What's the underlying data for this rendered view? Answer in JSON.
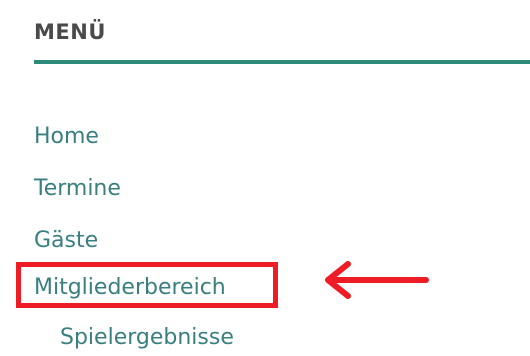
{
  "menu": {
    "title": "MENÜ",
    "items": [
      {
        "label": "Home"
      },
      {
        "label": "Termine"
      },
      {
        "label": "Gäste"
      },
      {
        "label": "Mitgliederbereich"
      },
      {
        "label": "Spielergebnisse"
      }
    ],
    "highlighted_item": "Mitgliederbereich"
  },
  "colors": {
    "accent": "#2e8a7a",
    "link": "#3a7f80",
    "title": "#4a4a4a",
    "annotation": "#ee1c24"
  },
  "annotation": {
    "arrow_icon": "arrow-left-icon"
  }
}
